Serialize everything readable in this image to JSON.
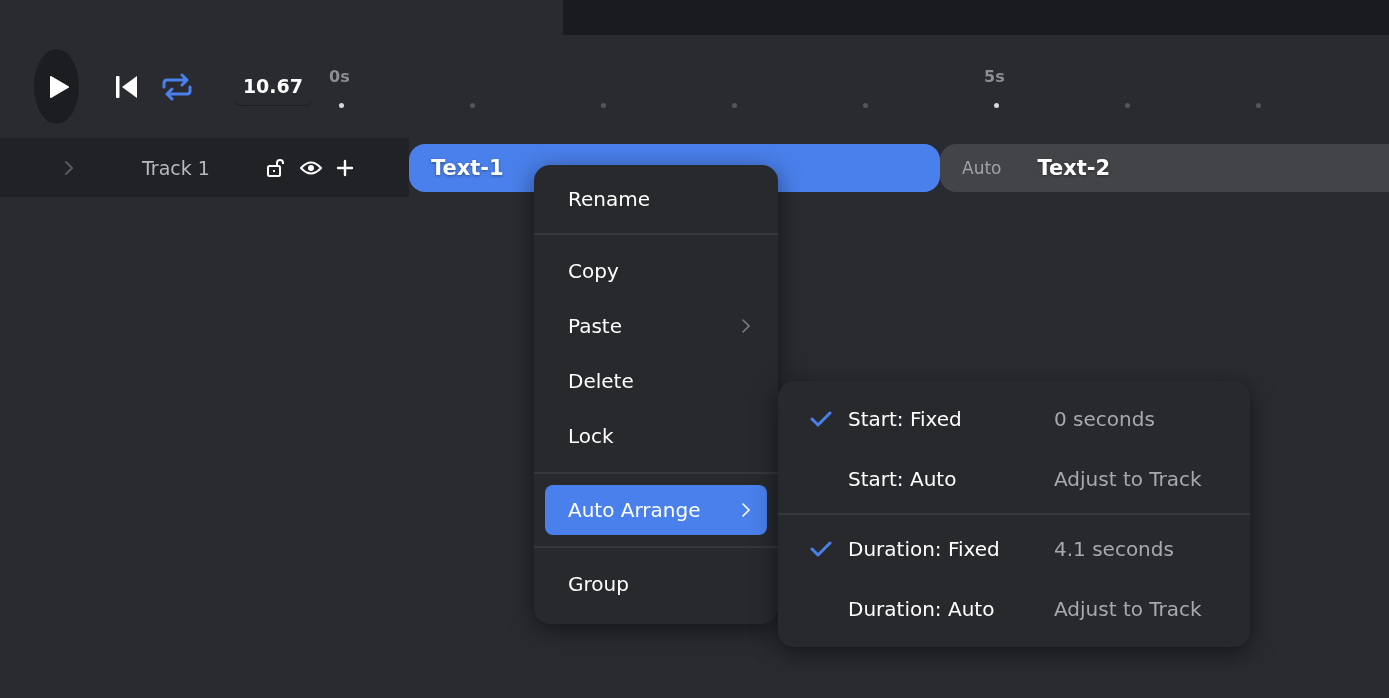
{
  "toolbar": {
    "time": "10.67",
    "loop": {
      "on": true
    }
  },
  "ruler": {
    "ticks": [
      {
        "major": true,
        "label": "0s"
      },
      {
        "major": false
      },
      {
        "major": false
      },
      {
        "major": false
      },
      {
        "major": false
      },
      {
        "major": true,
        "label": "5s"
      },
      {
        "major": false
      },
      {
        "major": false
      }
    ]
  },
  "track": {
    "name": "Track 1",
    "expanded": false,
    "locked": false,
    "clips": [
      {
        "name": "Text-1",
        "selected": true
      },
      {
        "name": "Text-2",
        "selected": false,
        "tag": "Auto"
      }
    ]
  },
  "context_menu": {
    "groups": [
      [
        {
          "label": "Rename",
          "submenu": false,
          "selected": false
        }
      ],
      [
        {
          "label": "Copy",
          "submenu": false,
          "selected": false
        },
        {
          "label": "Paste",
          "submenu": true,
          "selected": false
        },
        {
          "label": "Delete",
          "submenu": false,
          "selected": false
        },
        {
          "label": "Lock",
          "submenu": false,
          "selected": false
        }
      ],
      [
        {
          "label": "Auto Arrange",
          "submenu": true,
          "selected": true
        }
      ],
      [
        {
          "label": "Group",
          "submenu": false,
          "selected": false
        }
      ]
    ]
  },
  "submenu": {
    "groups": [
      [
        {
          "label": "Start: Fixed",
          "value": "0 seconds",
          "checked": true
        },
        {
          "label": "Start: Auto",
          "value": "Adjust to Track",
          "checked": false
        }
      ],
      [
        {
          "label": "Duration: Fixed",
          "value": "4.1 seconds",
          "checked": true
        },
        {
          "label": "Duration: Auto",
          "value": "Adjust to Track",
          "checked": false
        }
      ]
    ]
  }
}
